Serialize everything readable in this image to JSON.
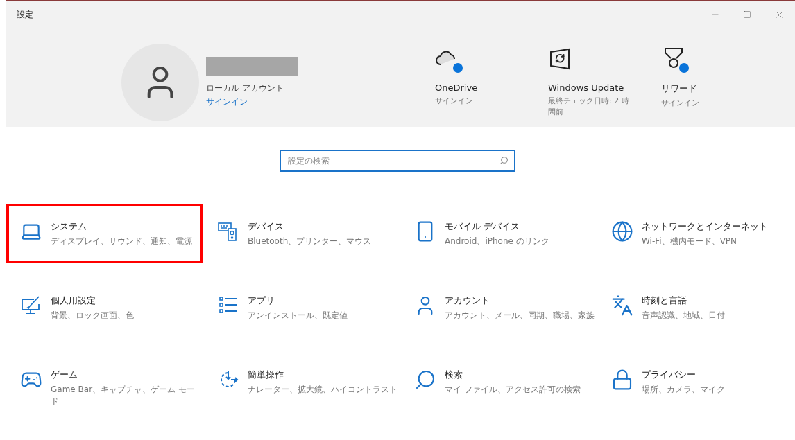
{
  "window": {
    "title": "設定"
  },
  "account": {
    "type": "ローカル アカウント",
    "link": "サインイン"
  },
  "services": [
    {
      "name": "OneDrive",
      "status": "サインイン",
      "badge": true
    },
    {
      "name": "Windows Update",
      "status": "最終チェック日時: 2 時間前",
      "badge": false
    },
    {
      "name": "リワード",
      "status": "サインイン",
      "badge": true
    }
  ],
  "search": {
    "placeholder": "設定の検索"
  },
  "categories": [
    {
      "title": "システム",
      "desc": "ディスプレイ、サウンド、通知、電源",
      "highlighted": true
    },
    {
      "title": "デバイス",
      "desc": "Bluetooth、プリンター、マウス",
      "highlighted": false
    },
    {
      "title": "モバイル デバイス",
      "desc": "Android、iPhone のリンク",
      "highlighted": false
    },
    {
      "title": "ネットワークとインターネット",
      "desc": "Wi-Fi、機内モード、VPN",
      "highlighted": false
    },
    {
      "title": "個人用設定",
      "desc": "背景、ロック画面、色",
      "highlighted": false
    },
    {
      "title": "アプリ",
      "desc": "アンインストール、既定値",
      "highlighted": false
    },
    {
      "title": "アカウント",
      "desc": "アカウント、メール、同期、職場、家族",
      "highlighted": false
    },
    {
      "title": "時刻と言語",
      "desc": "音声認識、地域、日付",
      "highlighted": false
    },
    {
      "title": "ゲーム",
      "desc": "Game Bar、キャプチャ、ゲーム モード",
      "highlighted": false
    },
    {
      "title": "簡単操作",
      "desc": "ナレーター、拡大鏡、ハイコントラスト",
      "highlighted": false
    },
    {
      "title": "検索",
      "desc": "マイ ファイル、アクセス許可の検索",
      "highlighted": false
    },
    {
      "title": "プライバシー",
      "desc": "場所、カメラ、マイク",
      "highlighted": false
    }
  ]
}
